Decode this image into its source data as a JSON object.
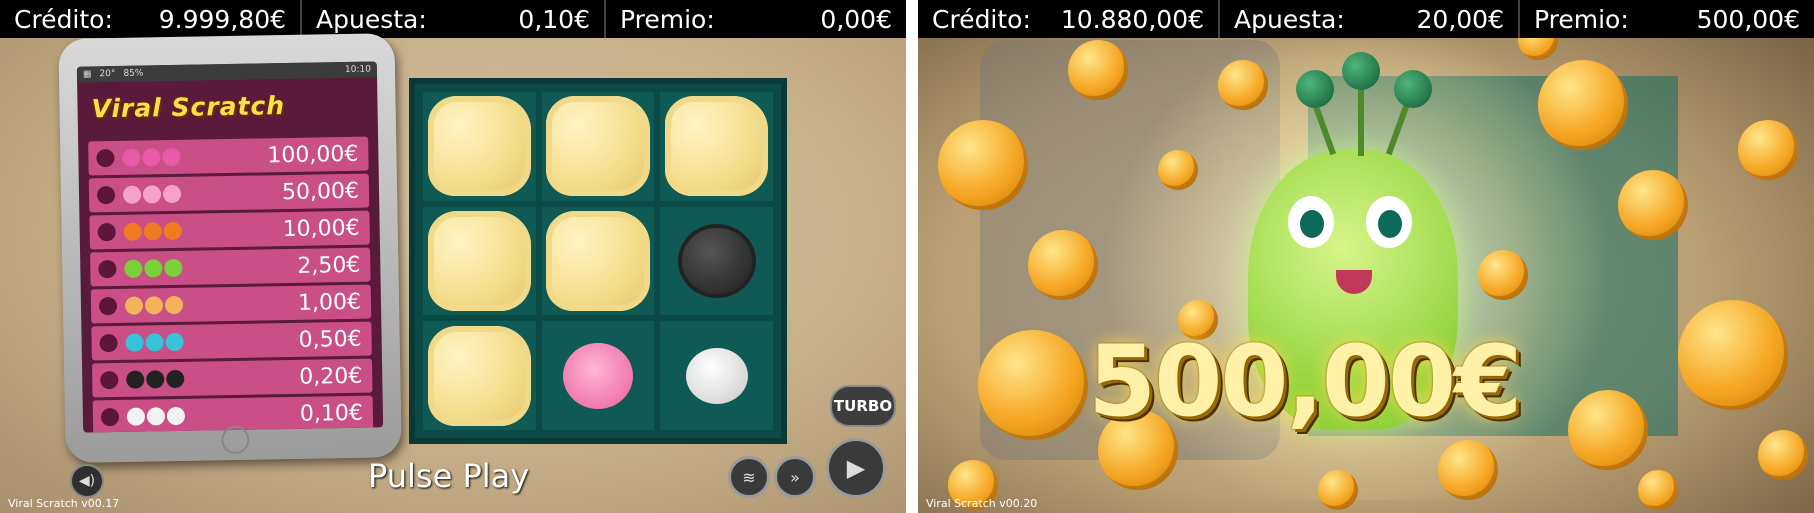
{
  "left": {
    "topbar": {
      "credit_label": "Crédito:",
      "credit_value": "9.999,80€",
      "bet_label": "Apuesta:",
      "bet_value": "0,10€",
      "prize_label": "Premio:",
      "prize_value": "0,00€"
    },
    "phone": {
      "status": {
        "temp": "20°",
        "battery": "85%",
        "time": "10:10"
      },
      "logo": "Viral Scratch",
      "paytable": [
        {
          "amount": "100,00€",
          "symbol_color": "#e85aa8"
        },
        {
          "amount": "50,00€",
          "symbol_color": "#f6a2c8"
        },
        {
          "amount": "10,00€",
          "symbol_color": "#f07a1f"
        },
        {
          "amount": "2,50€",
          "symbol_color": "#7bd13a"
        },
        {
          "amount": "1,00€",
          "symbol_color": "#f2b35a"
        },
        {
          "amount": "0,50€",
          "symbol_color": "#39c3d8"
        },
        {
          "amount": "0,20€",
          "symbol_color": "#222222"
        },
        {
          "amount": "0,10€",
          "symbol_color": "#f2f2f2"
        }
      ]
    },
    "grid": [
      {
        "state": "covered"
      },
      {
        "state": "covered"
      },
      {
        "state": "covered"
      },
      {
        "state": "covered"
      },
      {
        "state": "covered"
      },
      {
        "state": "revealed",
        "symbol": "spiky-monster"
      },
      {
        "state": "covered"
      },
      {
        "state": "revealed",
        "symbol": "pink-monster"
      },
      {
        "state": "revealed",
        "symbol": "cow-monster"
      }
    ],
    "turbo_label": "TURBO",
    "branding": "Pulse Play",
    "version": "Viral Scratch v00.17"
  },
  "right": {
    "topbar": {
      "credit_label": "Crédito:",
      "credit_value": "10.880,00€",
      "bet_label": "Apuesta:",
      "bet_value": "20,00€",
      "prize_label": "Premio:",
      "prize_value": "500,00€"
    },
    "win_amount": "500,00€",
    "version": "Viral Scratch v00.20"
  }
}
